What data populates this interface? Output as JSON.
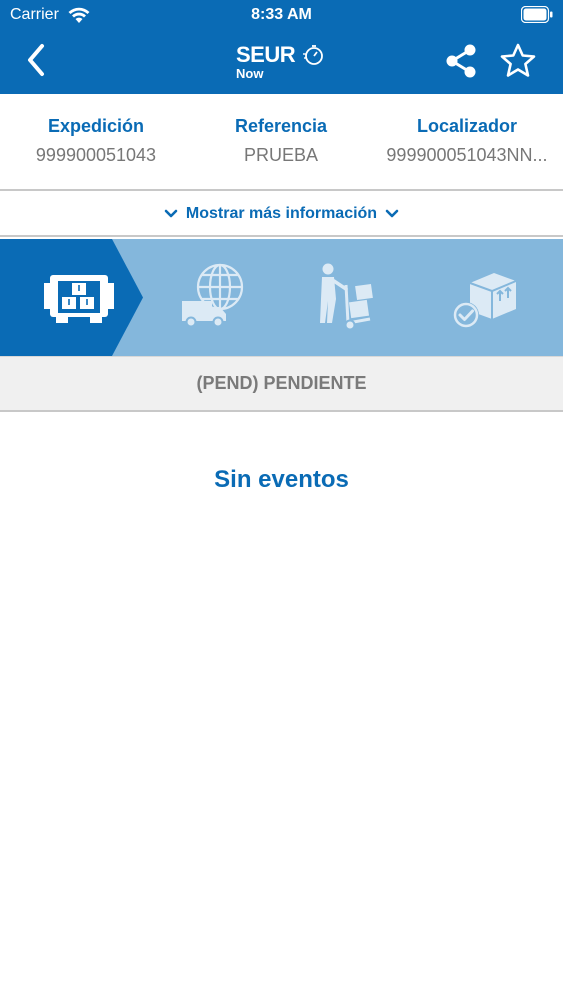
{
  "status_bar": {
    "carrier": "Carrier",
    "time": "8:33 AM"
  },
  "nav": {
    "brand": "SEUR",
    "brand_sub": "Now",
    "back_icon": "chevron-left-icon",
    "share_icon": "share-icon",
    "favorite_icon": "star-outline-icon"
  },
  "info": {
    "expedicion": {
      "label": "Expedición",
      "value": "999900051043"
    },
    "referencia": {
      "label": "Referencia",
      "value": "PRUEBA"
    },
    "localizador": {
      "label": "Localizador",
      "value": "999900051043NN..."
    }
  },
  "more_info": {
    "label": "Mostrar más información"
  },
  "steps": [
    {
      "icon": "warehouse-packages-icon",
      "active": true
    },
    {
      "icon": "van-globe-icon",
      "active": false
    },
    {
      "icon": "delivery-person-hand-truck-icon",
      "active": false
    },
    {
      "icon": "package-delivered-check-icon",
      "active": false
    }
  ],
  "shipment_status": "(PEND) PENDIENTE",
  "events_empty_text": "Sin eventos",
  "colors": {
    "brand_blue": "#0a6bb5",
    "steps_light": "#84b7dc",
    "text_gray": "#777777"
  }
}
